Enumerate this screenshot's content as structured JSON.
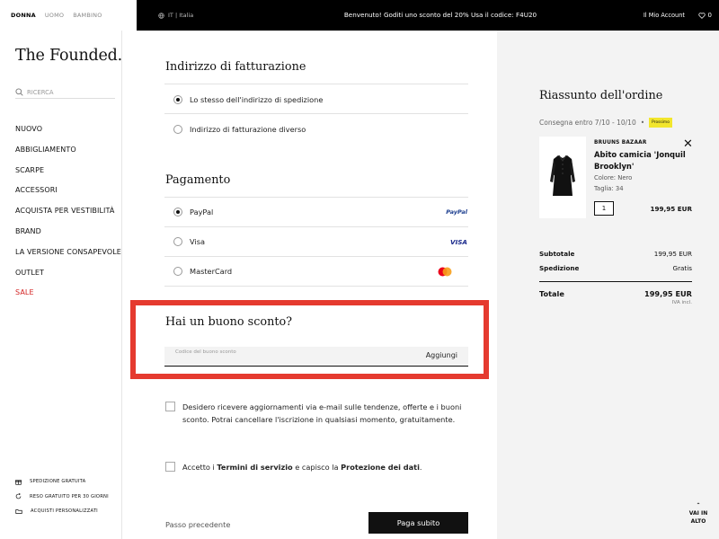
{
  "topbar": {
    "genders": [
      "DONNA",
      "UOMO",
      "BAMBINO"
    ],
    "locale": "IT | Italia",
    "promo": "Benvenuto! Goditi uno sconto del 20% Usa il codice: F4U20",
    "account": "Il Mio Account",
    "wishlist_count": "0"
  },
  "sidebar": {
    "logo": "The Founded.",
    "search_placeholder": "RICERCA",
    "nav": [
      "NUOVO",
      "ABBIGLIAMENTO",
      "SCARPE",
      "ACCESSORI",
      "ACQUISTA PER VESTIBILITÀ",
      "BRAND",
      "LA VERSIONE CONSAPEVOLE",
      "OUTLET",
      "SALE"
    ],
    "perks": [
      "SPEDIZIONE GRATUITA",
      "RESO GRATUITO PER 30 GIORNI",
      "ACQUISTI PERSONALIZZATI"
    ]
  },
  "billing": {
    "title": "Indirizzo di fatturazione",
    "options": [
      "Lo stesso dell'indirizzo di spedizione",
      "Indirizzo di fatturazione diverso"
    ]
  },
  "payment": {
    "title": "Pagamento",
    "options": [
      "PayPal",
      "Visa",
      "MasterCard"
    ],
    "paypal_logo": "PayPal",
    "visa_logo": "VISA"
  },
  "voucher": {
    "title": "Hai un buono sconto?",
    "placeholder": "Codice del buono sconto",
    "add_label": "Aggiungi"
  },
  "consents": {
    "newsletter": "Desidero ricevere aggiornamenti via e-mail sulle tendenze, offerte e i buoni sconto. Potrai cancellare l'iscrizione in qualsiasi momento, gratuitamente.",
    "terms_prefix": "Accetto i ",
    "terms_link": "Termini di servizio",
    "terms_mid": " e capisco la ",
    "privacy_link": "Protezione dei dati",
    "terms_suffix": "."
  },
  "footer": {
    "previous": "Passo precedente",
    "pay_now": "Paga subito"
  },
  "summary": {
    "title": "Riassunto dell'ordine",
    "delivery": "Consegna entro 7/10 - 10/10",
    "delivery_sep": "•",
    "badge": "Prossimo",
    "product": {
      "brand": "BRUUNS BAZAAR",
      "name": "Abito camicia 'Jonquil Brooklyn'",
      "color": "Colore: Nero",
      "size": "Taglia: 34",
      "qty": "1",
      "price": "199,95 EUR"
    },
    "subtotal_label": "Subtotale",
    "subtotal_value": "199,95 EUR",
    "shipping_label": "Spedizione",
    "shipping_value": "Gratis",
    "total_label": "Totale",
    "total_value": "199,95 EUR",
    "vat_note": "IVA incl."
  },
  "back_to_top": "VAI IN ALTO",
  "colors": {
    "highlight_frame": "#e53a2f",
    "sale": "#d32424",
    "badge": "#f2e62d"
  }
}
